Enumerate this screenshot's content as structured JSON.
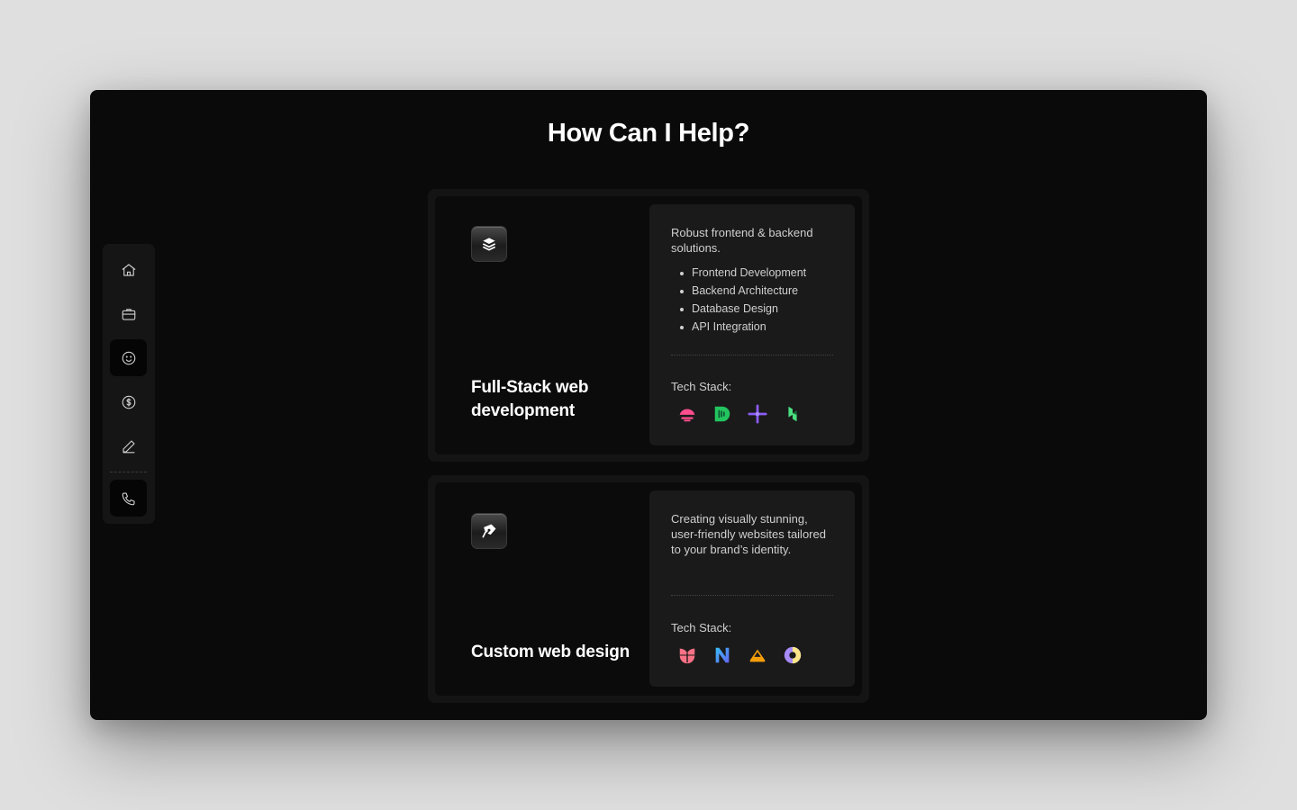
{
  "page": {
    "title": "How Can I Help?"
  },
  "sidebar": {
    "items": [
      {
        "name": "home",
        "icon": "home-icon"
      },
      {
        "name": "work",
        "icon": "briefcase-icon"
      },
      {
        "name": "about",
        "icon": "smiley-icon",
        "active": true
      },
      {
        "name": "pricing",
        "icon": "dollar-icon"
      },
      {
        "name": "blog",
        "icon": "pen-icon"
      },
      {
        "name": "contact",
        "icon": "phone-icon"
      }
    ]
  },
  "services": [
    {
      "icon": "layers-icon",
      "title": "Full-Stack web development",
      "description": "Robust frontend & backend solutions.",
      "features": [
        "Frontend Development",
        "Backend Architecture",
        "Database Design",
        "API Integration"
      ],
      "tech_label": "Tech Stack:",
      "tech_icons": [
        "svelte-icon",
        "drizzle-icon",
        "plus-sparkle-icon",
        "hono-icon"
      ]
    },
    {
      "icon": "pen-tool-icon",
      "title": "Custom web design",
      "description": "Creating visually stunning, user-friendly websites tailored to your brand’s identity.",
      "tech_label": "Tech Stack:",
      "tech_icons": [
        "framer-heart-icon",
        "nuxt-n-icon",
        "pile-icon",
        "pie-icon"
      ]
    }
  ],
  "colors": {
    "window_bg": "#0a0a0a",
    "card_bg": "#141414",
    "detail_bg": "#1a1a1a",
    "text": "#ffffff",
    "muted_text": "#cfcfcf"
  }
}
